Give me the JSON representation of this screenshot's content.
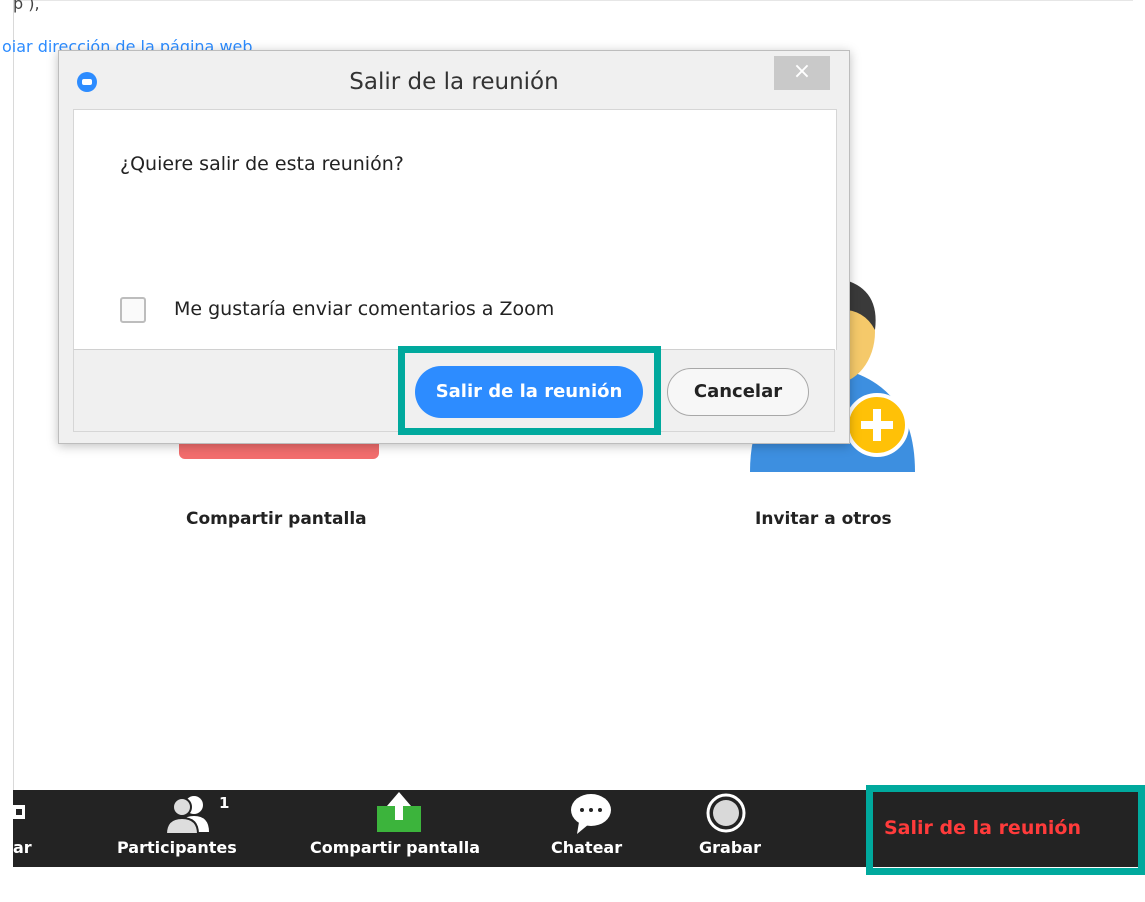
{
  "background": {
    "top_text": "p            ),",
    "top_link": "oiar dirección de la página web",
    "share_label": "Compartir pantalla",
    "invite_label": "Invitar a otros"
  },
  "dialog": {
    "title": "Salir de la reunión",
    "close_icon": "close-icon",
    "close_glyph": "×",
    "question": "¿Quiere salir de esta reunión?",
    "checkbox_label": "Me gustaría enviar comentarios a Zoom",
    "checkbox_checked": false,
    "leave_button": "Salir de la reunión",
    "cancel_button": "Cancelar"
  },
  "toolbar": {
    "partial_label": "ar",
    "participants_label": "Participantes",
    "participants_count": "1",
    "share_label": "Compartir pantalla",
    "chat_label": "Chatear",
    "record_label": "Grabar",
    "leave_label": "Salir de la reunión"
  },
  "colors": {
    "accent": "#2d8cff",
    "highlight": "#00a99d",
    "leave_red": "#ff3b3b",
    "share_green": "#3cb43c"
  }
}
